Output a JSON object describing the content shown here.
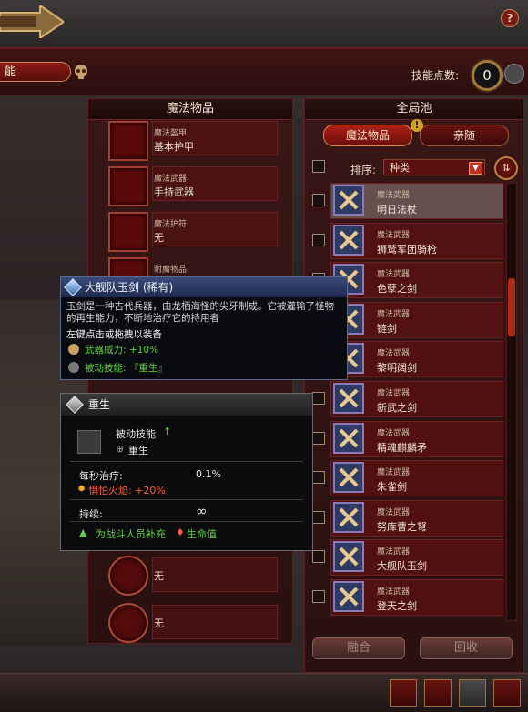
{
  "header": {
    "name_label": "能"
  },
  "skill_points": {
    "label": "技能点数:",
    "value": "0"
  },
  "left_panel": {
    "title": "魔法物品",
    "slots": [
      {
        "category": "魔法盔甲",
        "value": "基本护甲"
      },
      {
        "category": "魔法武器",
        "value": "手持武器"
      },
      {
        "category": "魔法护符",
        "value": "无"
      },
      {
        "category": "附魔物品",
        "value": ""
      }
    ],
    "lower_slots": [
      "无",
      "无",
      "无"
    ]
  },
  "right_panel": {
    "title": "全局池",
    "tabs": [
      "魔法物品",
      "亲随"
    ],
    "sort_label": "排序:",
    "sort_value": "种类",
    "items": [
      {
        "category": "魔法武器",
        "name": "明日法杖"
      },
      {
        "category": "魔法武器",
        "name": "狮鹫军团骑枪"
      },
      {
        "category": "魔法武器",
        "name": "色孽之剑"
      },
      {
        "category": "魔法武器",
        "name": "链剑"
      },
      {
        "category": "魔法武器",
        "name": "黎明阔剑"
      },
      {
        "category": "魔法武器",
        "name": "新武之剑"
      },
      {
        "category": "魔法武器",
        "name": "精魂麒麟矛"
      },
      {
        "category": "魔法武器",
        "name": "朱雀剑"
      },
      {
        "category": "魔法武器",
        "name": "努库曹之弩"
      },
      {
        "category": "魔法武器",
        "name": "大舰队玉剑"
      },
      {
        "category": "魔法武器",
        "name": "登天之剑"
      }
    ],
    "merge_button": "融合",
    "recycle_button": "回收"
  },
  "tooltip_item": {
    "title": "大舰队玉剑 (稀有)",
    "desc": "玉剑是一种古代兵器，由龙栖海怪的尖牙制成。它被灌输了怪物的再生能力，不断地治疗它的持用者",
    "hint": "左键点击或拖拽以装备",
    "stat1": "武器威力: +10%",
    "stat2": "被动技能: 『重生』"
  },
  "tooltip_skill": {
    "title": "重生",
    "type": "被动技能",
    "name": "重生",
    "heal_label": "每秒治疗:",
    "heal_value": "0.1%",
    "fear_fire": "惧怕火焰: +20%",
    "duration_label": "持续:",
    "duration_value": "∞",
    "effect_prefix": "为战斗人员补充",
    "effect_suffix": "生命值"
  },
  "colors": {
    "accent_red": "#b02018",
    "gold": "#c8a060",
    "green": "#60d040",
    "fear_red": "#ff5a3a"
  }
}
